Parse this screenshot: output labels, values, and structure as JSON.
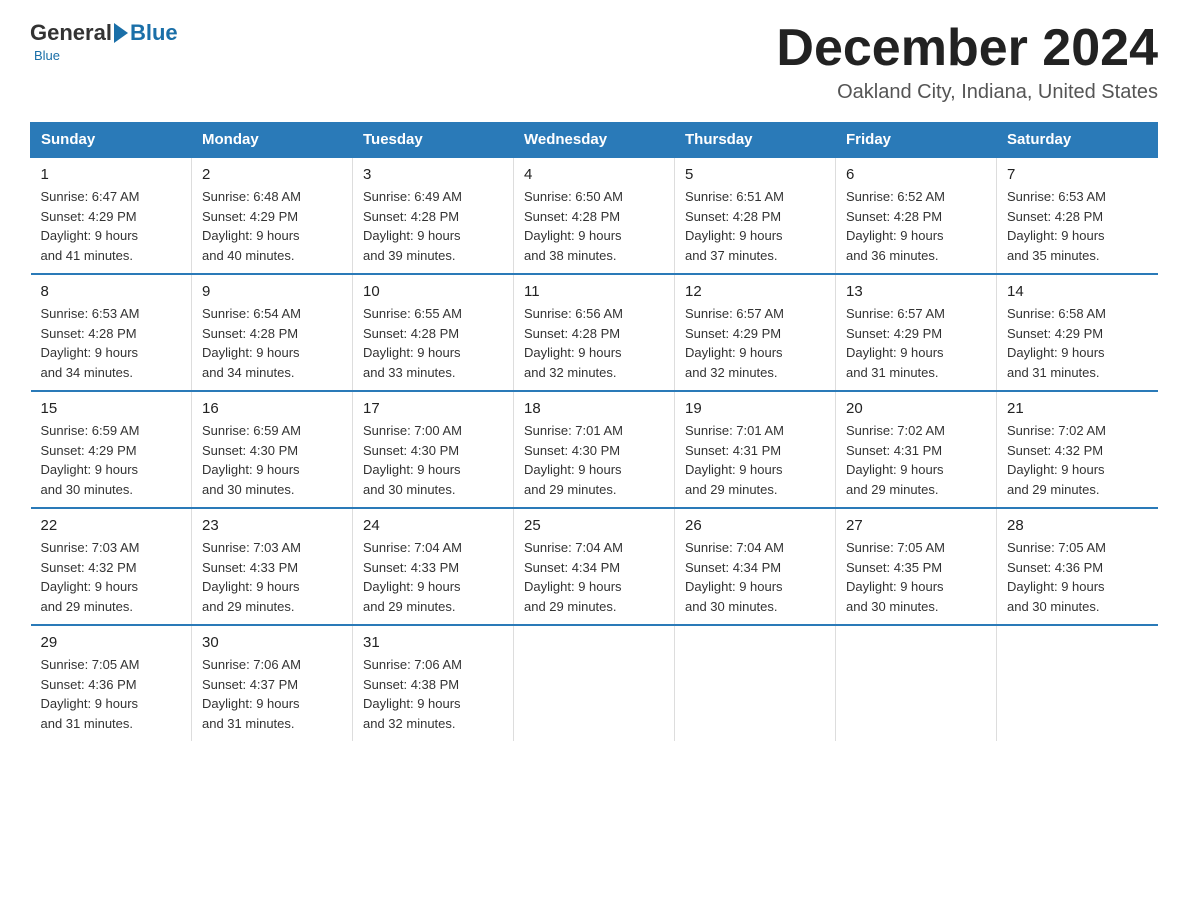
{
  "logo": {
    "general": "General",
    "blue": "Blue",
    "underline": "Blue"
  },
  "header": {
    "title": "December 2024",
    "subtitle": "Oakland City, Indiana, United States"
  },
  "weekdays": [
    "Sunday",
    "Monday",
    "Tuesday",
    "Wednesday",
    "Thursday",
    "Friday",
    "Saturday"
  ],
  "weeks": [
    [
      {
        "day": "1",
        "sunrise": "6:47 AM",
        "sunset": "4:29 PM",
        "daylight": "9 hours and 41 minutes."
      },
      {
        "day": "2",
        "sunrise": "6:48 AM",
        "sunset": "4:29 PM",
        "daylight": "9 hours and 40 minutes."
      },
      {
        "day": "3",
        "sunrise": "6:49 AM",
        "sunset": "4:28 PM",
        "daylight": "9 hours and 39 minutes."
      },
      {
        "day": "4",
        "sunrise": "6:50 AM",
        "sunset": "4:28 PM",
        "daylight": "9 hours and 38 minutes."
      },
      {
        "day": "5",
        "sunrise": "6:51 AM",
        "sunset": "4:28 PM",
        "daylight": "9 hours and 37 minutes."
      },
      {
        "day": "6",
        "sunrise": "6:52 AM",
        "sunset": "4:28 PM",
        "daylight": "9 hours and 36 minutes."
      },
      {
        "day": "7",
        "sunrise": "6:53 AM",
        "sunset": "4:28 PM",
        "daylight": "9 hours and 35 minutes."
      }
    ],
    [
      {
        "day": "8",
        "sunrise": "6:53 AM",
        "sunset": "4:28 PM",
        "daylight": "9 hours and 34 minutes."
      },
      {
        "day": "9",
        "sunrise": "6:54 AM",
        "sunset": "4:28 PM",
        "daylight": "9 hours and 34 minutes."
      },
      {
        "day": "10",
        "sunrise": "6:55 AM",
        "sunset": "4:28 PM",
        "daylight": "9 hours and 33 minutes."
      },
      {
        "day": "11",
        "sunrise": "6:56 AM",
        "sunset": "4:28 PM",
        "daylight": "9 hours and 32 minutes."
      },
      {
        "day": "12",
        "sunrise": "6:57 AM",
        "sunset": "4:29 PM",
        "daylight": "9 hours and 32 minutes."
      },
      {
        "day": "13",
        "sunrise": "6:57 AM",
        "sunset": "4:29 PM",
        "daylight": "9 hours and 31 minutes."
      },
      {
        "day": "14",
        "sunrise": "6:58 AM",
        "sunset": "4:29 PM",
        "daylight": "9 hours and 31 minutes."
      }
    ],
    [
      {
        "day": "15",
        "sunrise": "6:59 AM",
        "sunset": "4:29 PM",
        "daylight": "9 hours and 30 minutes."
      },
      {
        "day": "16",
        "sunrise": "6:59 AM",
        "sunset": "4:30 PM",
        "daylight": "9 hours and 30 minutes."
      },
      {
        "day": "17",
        "sunrise": "7:00 AM",
        "sunset": "4:30 PM",
        "daylight": "9 hours and 30 minutes."
      },
      {
        "day": "18",
        "sunrise": "7:01 AM",
        "sunset": "4:30 PM",
        "daylight": "9 hours and 29 minutes."
      },
      {
        "day": "19",
        "sunrise": "7:01 AM",
        "sunset": "4:31 PM",
        "daylight": "9 hours and 29 minutes."
      },
      {
        "day": "20",
        "sunrise": "7:02 AM",
        "sunset": "4:31 PM",
        "daylight": "9 hours and 29 minutes."
      },
      {
        "day": "21",
        "sunrise": "7:02 AM",
        "sunset": "4:32 PM",
        "daylight": "9 hours and 29 minutes."
      }
    ],
    [
      {
        "day": "22",
        "sunrise": "7:03 AM",
        "sunset": "4:32 PM",
        "daylight": "9 hours and 29 minutes."
      },
      {
        "day": "23",
        "sunrise": "7:03 AM",
        "sunset": "4:33 PM",
        "daylight": "9 hours and 29 minutes."
      },
      {
        "day": "24",
        "sunrise": "7:04 AM",
        "sunset": "4:33 PM",
        "daylight": "9 hours and 29 minutes."
      },
      {
        "day": "25",
        "sunrise": "7:04 AM",
        "sunset": "4:34 PM",
        "daylight": "9 hours and 29 minutes."
      },
      {
        "day": "26",
        "sunrise": "7:04 AM",
        "sunset": "4:34 PM",
        "daylight": "9 hours and 30 minutes."
      },
      {
        "day": "27",
        "sunrise": "7:05 AM",
        "sunset": "4:35 PM",
        "daylight": "9 hours and 30 minutes."
      },
      {
        "day": "28",
        "sunrise": "7:05 AM",
        "sunset": "4:36 PM",
        "daylight": "9 hours and 30 minutes."
      }
    ],
    [
      {
        "day": "29",
        "sunrise": "7:05 AM",
        "sunset": "4:36 PM",
        "daylight": "9 hours and 31 minutes."
      },
      {
        "day": "30",
        "sunrise": "7:06 AM",
        "sunset": "4:37 PM",
        "daylight": "9 hours and 31 minutes."
      },
      {
        "day": "31",
        "sunrise": "7:06 AM",
        "sunset": "4:38 PM",
        "daylight": "9 hours and 32 minutes."
      },
      null,
      null,
      null,
      null
    ]
  ],
  "labels": {
    "sunrise": "Sunrise:",
    "sunset": "Sunset:",
    "daylight": "Daylight:"
  }
}
